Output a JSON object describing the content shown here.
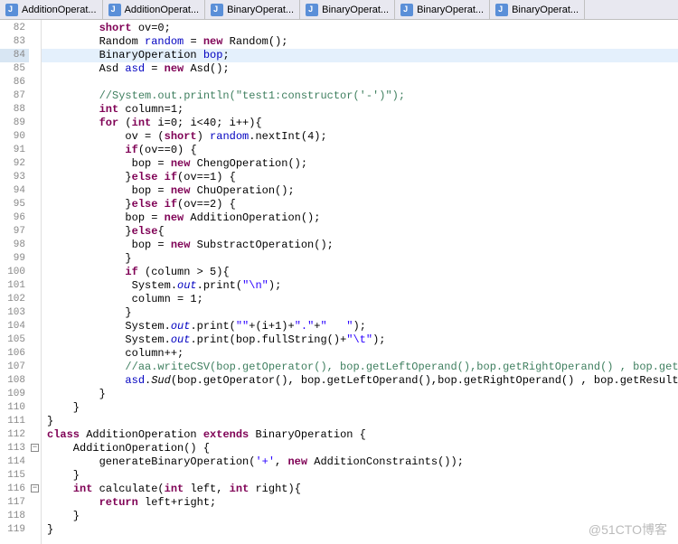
{
  "tabs": [
    {
      "label": "AdditionOperat..."
    },
    {
      "label": "AdditionOperat..."
    },
    {
      "label": "BinaryOperat..."
    },
    {
      "label": "BinaryOperat..."
    },
    {
      "label": "BinaryOperat..."
    },
    {
      "label": "BinaryOperat..."
    }
  ],
  "watermark": "@51CTO博客",
  "lines": [
    {
      "n": 82,
      "tokens": [
        {
          "t": "        "
        },
        {
          "t": "short",
          "c": "kw"
        },
        {
          "t": " ov=0;"
        }
      ]
    },
    {
      "n": 83,
      "tokens": [
        {
          "t": "        Random "
        },
        {
          "t": "random",
          "c": "fld"
        },
        {
          "t": " = "
        },
        {
          "t": "new",
          "c": "kw"
        },
        {
          "t": " Random();"
        }
      ]
    },
    {
      "n": 84,
      "hl": true,
      "tokens": [
        {
          "t": "        BinaryOperation "
        },
        {
          "t": "bop",
          "c": "fld"
        },
        {
          "t": ";"
        }
      ]
    },
    {
      "n": 85,
      "tokens": [
        {
          "t": "        Asd "
        },
        {
          "t": "asd",
          "c": "fld"
        },
        {
          "t": " = "
        },
        {
          "t": "new",
          "c": "kw"
        },
        {
          "t": " Asd();"
        }
      ]
    },
    {
      "n": 86,
      "tokens": []
    },
    {
      "n": 87,
      "tokens": [
        {
          "t": "        "
        },
        {
          "t": "//System.out.println(\"test1:constructor('-')\");",
          "c": "cm"
        }
      ]
    },
    {
      "n": 88,
      "tokens": [
        {
          "t": "        "
        },
        {
          "t": "int",
          "c": "kw"
        },
        {
          "t": " column=1;"
        }
      ]
    },
    {
      "n": 89,
      "tokens": [
        {
          "t": "        "
        },
        {
          "t": "for",
          "c": "kw"
        },
        {
          "t": " ("
        },
        {
          "t": "int",
          "c": "kw"
        },
        {
          "t": " i=0; i<40; i++){"
        }
      ]
    },
    {
      "n": 90,
      "tokens": [
        {
          "t": "            ov = ("
        },
        {
          "t": "short",
          "c": "kw"
        },
        {
          "t": ") "
        },
        {
          "t": "random",
          "c": "fld"
        },
        {
          "t": ".nextInt(4);"
        }
      ]
    },
    {
      "n": 91,
      "tokens": [
        {
          "t": "            "
        },
        {
          "t": "if",
          "c": "kw"
        },
        {
          "t": "(ov==0) {"
        }
      ]
    },
    {
      "n": 92,
      "tokens": [
        {
          "t": "             bop = "
        },
        {
          "t": "new",
          "c": "kw"
        },
        {
          "t": " ChengOperation();"
        }
      ]
    },
    {
      "n": 93,
      "tokens": [
        {
          "t": "            }"
        },
        {
          "t": "else if",
          "c": "kw"
        },
        {
          "t": "(ov==1) {"
        }
      ]
    },
    {
      "n": 94,
      "tokens": [
        {
          "t": "             bop = "
        },
        {
          "t": "new",
          "c": "kw"
        },
        {
          "t": " ChuOperation();"
        }
      ]
    },
    {
      "n": 95,
      "tokens": [
        {
          "t": "            }"
        },
        {
          "t": "else if",
          "c": "kw"
        },
        {
          "t": "(ov==2) {"
        }
      ]
    },
    {
      "n": 96,
      "tokens": [
        {
          "t": "            bop = "
        },
        {
          "t": "new",
          "c": "kw"
        },
        {
          "t": " AdditionOperation();"
        }
      ]
    },
    {
      "n": 97,
      "tokens": [
        {
          "t": "            }"
        },
        {
          "t": "else",
          "c": "kw"
        },
        {
          "t": "{"
        }
      ]
    },
    {
      "n": 98,
      "tokens": [
        {
          "t": "             bop = "
        },
        {
          "t": "new",
          "c": "kw"
        },
        {
          "t": " SubstractOperation();"
        }
      ]
    },
    {
      "n": 99,
      "tokens": [
        {
          "t": "            }"
        }
      ]
    },
    {
      "n": 100,
      "tokens": [
        {
          "t": "            "
        },
        {
          "t": "if",
          "c": "kw"
        },
        {
          "t": " (column > 5){"
        }
      ]
    },
    {
      "n": 101,
      "tokens": [
        {
          "t": "             System."
        },
        {
          "t": "out",
          "c": "fld it"
        },
        {
          "t": ".print("
        },
        {
          "t": "\"\\n\"",
          "c": "str"
        },
        {
          "t": ");"
        }
      ]
    },
    {
      "n": 102,
      "tokens": [
        {
          "t": "             column = 1;"
        }
      ]
    },
    {
      "n": 103,
      "tokens": [
        {
          "t": "            }"
        }
      ]
    },
    {
      "n": 104,
      "tokens": [
        {
          "t": "            System."
        },
        {
          "t": "out",
          "c": "fld it"
        },
        {
          "t": ".print("
        },
        {
          "t": "\"\"",
          "c": "str"
        },
        {
          "t": "+(i+1)+"
        },
        {
          "t": "\".\"",
          "c": "str"
        },
        {
          "t": "+"
        },
        {
          "t": "\"   \"",
          "c": "str"
        },
        {
          "t": ");"
        }
      ]
    },
    {
      "n": 105,
      "tokens": [
        {
          "t": "            System."
        },
        {
          "t": "out",
          "c": "fld it"
        },
        {
          "t": ".print(bop.fullString()+"
        },
        {
          "t": "\"\\t\"",
          "c": "str"
        },
        {
          "t": ");"
        }
      ]
    },
    {
      "n": 106,
      "tokens": [
        {
          "t": "            column++;"
        }
      ]
    },
    {
      "n": 107,
      "tokens": [
        {
          "t": "            "
        },
        {
          "t": "//aa.writeCSV(bop.getOperator(), bop.getLeftOperand(),bop.getRightOperand() , bop.getResult",
          "c": "cm"
        }
      ]
    },
    {
      "n": 108,
      "tokens": [
        {
          "t": "            "
        },
        {
          "t": "asd",
          "c": "fld"
        },
        {
          "t": "."
        },
        {
          "t": "Sud",
          "c": "it"
        },
        {
          "t": "(bop.getOperator(), bop.getLeftOperand(),bop.getRightOperand() , bop.getResult());"
        }
      ]
    },
    {
      "n": 109,
      "tokens": [
        {
          "t": "        }"
        }
      ]
    },
    {
      "n": 110,
      "tokens": [
        {
          "t": "    }"
        }
      ]
    },
    {
      "n": 111,
      "tokens": [
        {
          "t": "}"
        }
      ]
    },
    {
      "n": 112,
      "tokens": [
        {
          "t": "class",
          "c": "kw"
        },
        {
          "t": " AdditionOperation "
        },
        {
          "t": "extends",
          "c": "kw"
        },
        {
          "t": " BinaryOperation {"
        }
      ]
    },
    {
      "n": 113,
      "fold": true,
      "tokens": [
        {
          "t": "    AdditionOperation() {"
        }
      ]
    },
    {
      "n": 114,
      "tokens": [
        {
          "t": "        generateBinaryOperation("
        },
        {
          "t": "'+'",
          "c": "str"
        },
        {
          "t": ", "
        },
        {
          "t": "new",
          "c": "kw"
        },
        {
          "t": " AdditionConstraints());"
        }
      ]
    },
    {
      "n": 115,
      "tokens": [
        {
          "t": "    }"
        }
      ]
    },
    {
      "n": 116,
      "fold": true,
      "tokens": [
        {
          "t": "    "
        },
        {
          "t": "int",
          "c": "kw"
        },
        {
          "t": " calculate("
        },
        {
          "t": "int",
          "c": "kw"
        },
        {
          "t": " left, "
        },
        {
          "t": "int",
          "c": "kw"
        },
        {
          "t": " right){"
        }
      ]
    },
    {
      "n": 117,
      "tokens": [
        {
          "t": "        "
        },
        {
          "t": "return",
          "c": "kw"
        },
        {
          "t": " left+right;"
        }
      ]
    },
    {
      "n": 118,
      "tokens": [
        {
          "t": "    }"
        }
      ]
    },
    {
      "n": 119,
      "tokens": [
        {
          "t": "}"
        }
      ]
    }
  ]
}
